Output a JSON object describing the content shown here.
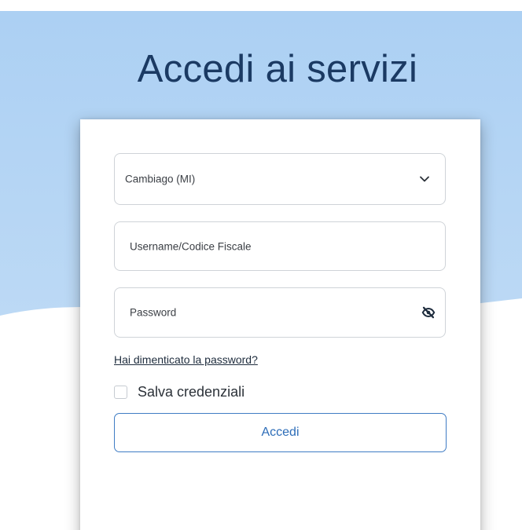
{
  "page": {
    "title": "Accedi ai servizi"
  },
  "login": {
    "municipality_select": {
      "value": "Cambiago (MI)"
    },
    "username_field": {
      "placeholder": "Username/Codice Fiscale"
    },
    "password_field": {
      "placeholder": "Password"
    },
    "forgot_password_link": "Hai dimenticato la password?",
    "remember_credentials": {
      "label": "Salva credenziali",
      "checked": false
    },
    "submit_button": "Accedi"
  },
  "icons": {
    "select_arrow": "chevron-down-icon",
    "password_toggle": "eye-slash-icon"
  },
  "colors": {
    "background_blue": "#a9cff3",
    "title": "#1b3a63",
    "button_accent": "#2d6db8"
  }
}
